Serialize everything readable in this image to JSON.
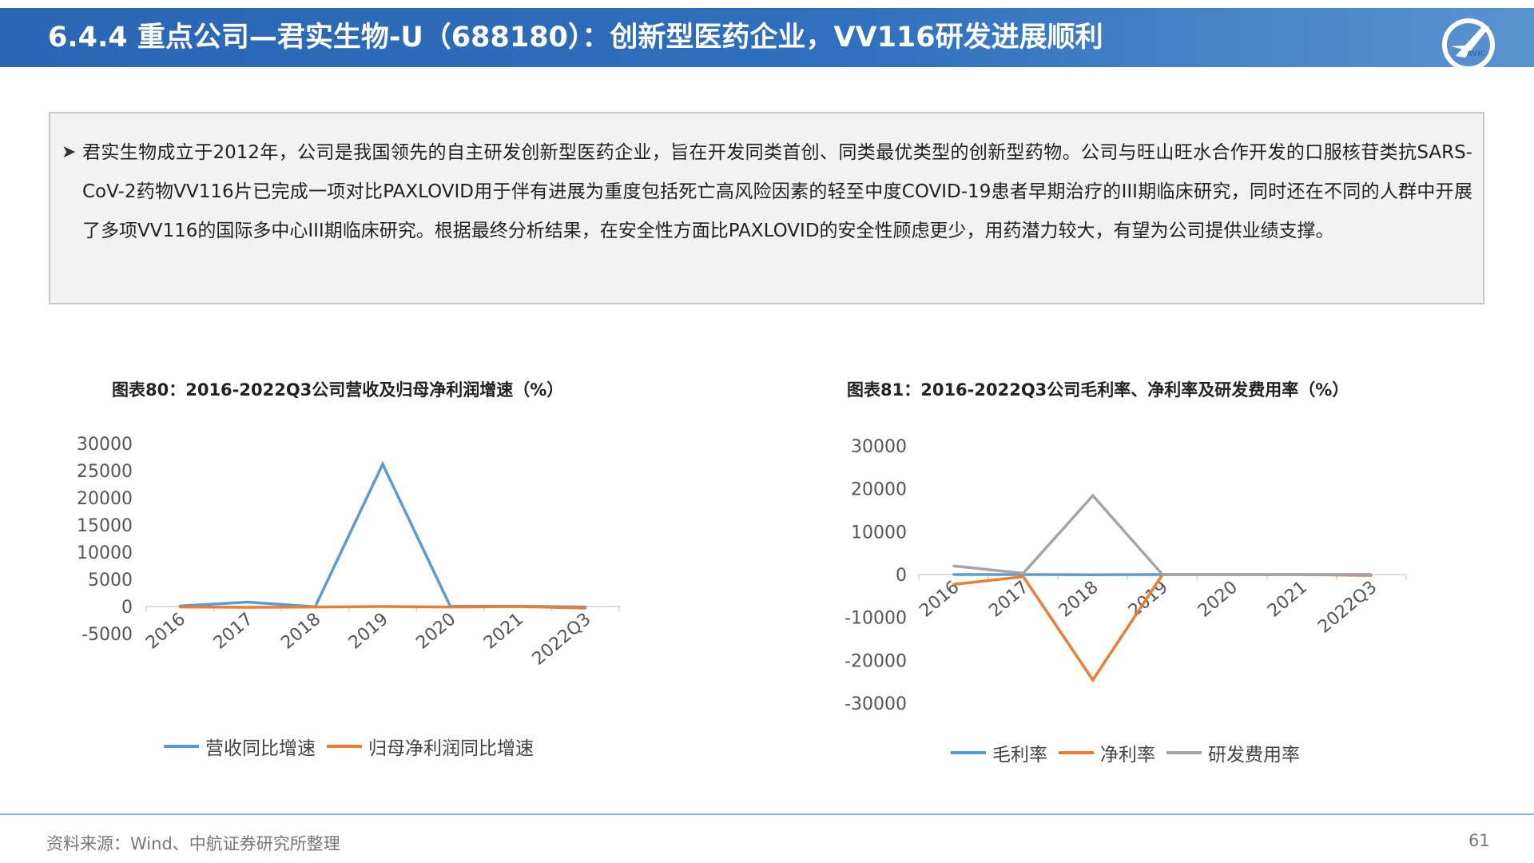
{
  "header": {
    "title": "6.4.4 重点公司—君实生物-U（688180）：创新型医药企业，VV116研发进展顺利",
    "logo_text": "AVIC"
  },
  "summary": {
    "bullet_icon": "arrow-bullet-icon",
    "text": "君实生物成立于2012年，公司是我国领先的自主研发创新型医药企业，旨在开发同类首创、同类最优类型的创新型药物。公司与旺山旺水合作开发的口服核苷类抗SARS-CoV-2药物VV116片已完成一项对比PAXLOVID用于伴有进展为重度包括死亡高风险因素的轻至中度COVID-19患者早期治疗的III期临床研究，同时还在不同的人群中开展了多项VV116的国际多中心III期临床研究。根据最终分析结果，在安全性方面比PAXLOVID的安全性顾虑更少，用药潜力较大，有望为公司提供业绩支撑。"
  },
  "footer": {
    "source": "资料来源：Wind、中航证券研究所整理",
    "page": "61"
  },
  "chart_data": [
    {
      "type": "line",
      "title": "图表80：2016-2022Q3公司营收及归母净利润增速（%）",
      "categories": [
        "2016",
        "2017",
        "2018",
        "2019",
        "2020",
        "2021",
        "2022Q3"
      ],
      "y_ticks": [
        "30000",
        "25000",
        "20000",
        "15000",
        "10000",
        "5000",
        "0",
        "-5000"
      ],
      "ylim": [
        -5000,
        30000
      ],
      "series": [
        {
          "name": "营收同比增速",
          "color": "#5b9bd5",
          "values": [
            100,
            800,
            -50,
            26200,
            50,
            50,
            -100
          ]
        },
        {
          "name": "归母净利润同比增速",
          "color": "#ed7d31",
          "values": [
            -100,
            -150,
            -100,
            0,
            -100,
            0,
            -300
          ]
        }
      ],
      "legend": "bottom",
      "grid": false
    },
    {
      "type": "line",
      "title": "图表81：2016-2022Q3公司毛利率、净利率及研发费用率（%）",
      "categories": [
        "2016",
        "2017",
        "2018",
        "2019",
        "2020",
        "2021",
        "2022Q3"
      ],
      "y_ticks": [
        "30000",
        "20000",
        "10000",
        "0",
        "-10000",
        "-20000",
        "-30000"
      ],
      "ylim": [
        -30000,
        30000
      ],
      "series": [
        {
          "name": "毛利率",
          "color": "#5b9bd5",
          "values": [
            0,
            0,
            -50,
            0,
            0,
            0,
            0
          ]
        },
        {
          "name": "净利率",
          "color": "#ed7d31",
          "values": [
            -2300,
            -500,
            -24600,
            0,
            0,
            0,
            -200
          ]
        },
        {
          "name": "研发费用率",
          "color": "#a5a5a5",
          "values": [
            2000,
            300,
            18400,
            0,
            0,
            0,
            0
          ]
        }
      ],
      "legend": "bottom",
      "grid": false
    }
  ]
}
